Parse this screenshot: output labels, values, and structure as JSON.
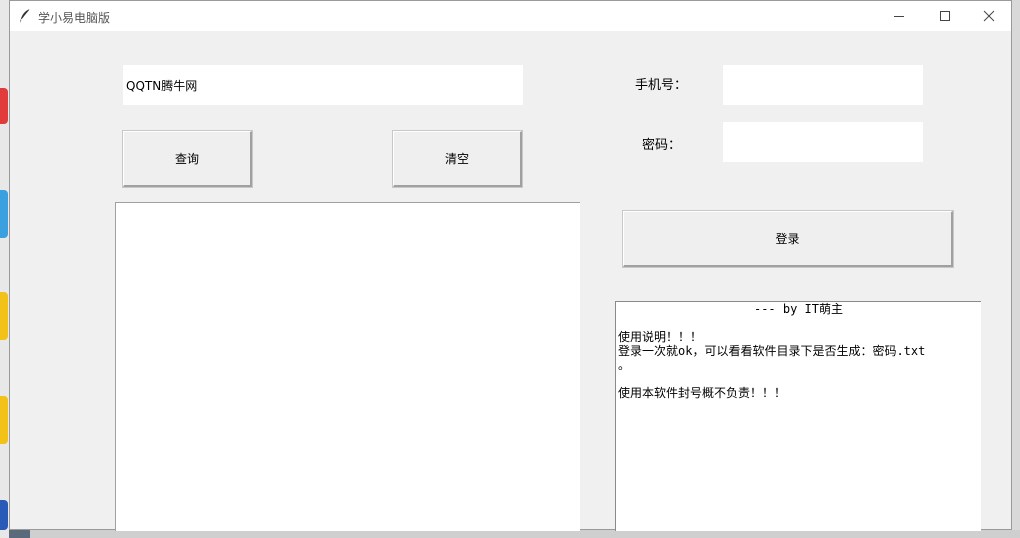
{
  "window": {
    "title": "学小易电脑版"
  },
  "query": {
    "input_value": "QQTN腾牛网",
    "search_label": "查询",
    "clear_label": "清空"
  },
  "login": {
    "phone_label": "手机号：",
    "phone_value": "",
    "password_label": "密码：",
    "password_value": "",
    "login_label": "登录"
  },
  "info": {
    "header": "--- by IT萌主",
    "lines": [
      "",
      "使用说明！！！",
      "登录一次就ok，可以看看软件目录下是否生成：密码.txt",
      "。",
      "",
      "使用本软件封号概不负责！！！"
    ]
  }
}
